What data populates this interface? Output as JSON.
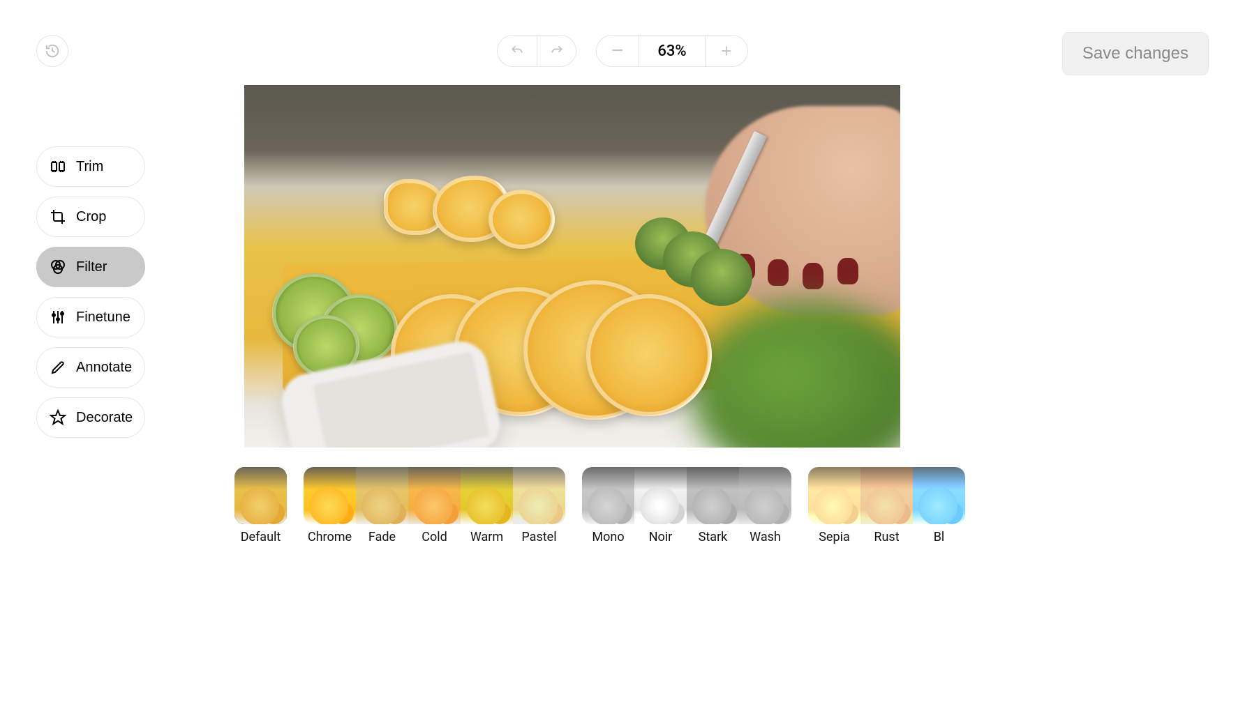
{
  "header": {
    "zoom_level": "63%",
    "save_label": "Save changes"
  },
  "sidebar": {
    "tools": [
      {
        "id": "trim",
        "label": "Trim",
        "icon": "trim-icon",
        "active": false
      },
      {
        "id": "crop",
        "label": "Crop",
        "icon": "crop-icon",
        "active": false
      },
      {
        "id": "filter",
        "label": "Filter",
        "icon": "filter-icon",
        "active": true
      },
      {
        "id": "finetune",
        "label": "Finetune",
        "icon": "finetune-icon",
        "active": false
      },
      {
        "id": "annotate",
        "label": "Annotate",
        "icon": "annotate-icon",
        "active": false
      },
      {
        "id": "decorate",
        "label": "Decorate",
        "icon": "decorate-icon",
        "active": false
      }
    ]
  },
  "filters": {
    "selected": "Default",
    "groups": [
      {
        "items": [
          {
            "label": "Default"
          }
        ],
        "single": true
      },
      {
        "items": [
          {
            "label": "Chrome",
            "css": "contrast(1.15) saturate(1.15)"
          },
          {
            "label": "Fade",
            "css": "contrast(0.85) brightness(1.08) saturate(0.85)"
          },
          {
            "label": "Cold",
            "css": "hue-rotate(-8deg) saturate(1.05) brightness(0.98)"
          },
          {
            "label": "Warm",
            "css": "hue-rotate(8deg) saturate(1.15) brightness(1.05)"
          },
          {
            "label": "Pastel",
            "css": "saturate(0.55) brightness(1.25) contrast(0.85)"
          }
        ]
      },
      {
        "items": [
          {
            "label": "Mono",
            "css": "grayscale(1) contrast(0.95) brightness(1.05)"
          },
          {
            "label": "Noir",
            "css": "grayscale(1) contrast(1.25) brightness(1.15)"
          },
          {
            "label": "Stark",
            "css": "grayscale(1) contrast(1.05) brightness(0.98)"
          },
          {
            "label": "Wash",
            "css": "grayscale(1) contrast(0.8) brightness(1.08)"
          }
        ]
      },
      {
        "items": [
          {
            "label": "Sepia",
            "css": "sepia(0.85) saturate(1.1) brightness(1.05)"
          },
          {
            "label": "Rust",
            "css": "sepia(0.95) hue-rotate(-12deg) saturate(1.25) brightness(0.95)"
          },
          {
            "label": "Bl",
            "css": "sepia(0.4) hue-rotate(160deg) saturate(1.1)"
          }
        ]
      }
    ]
  }
}
